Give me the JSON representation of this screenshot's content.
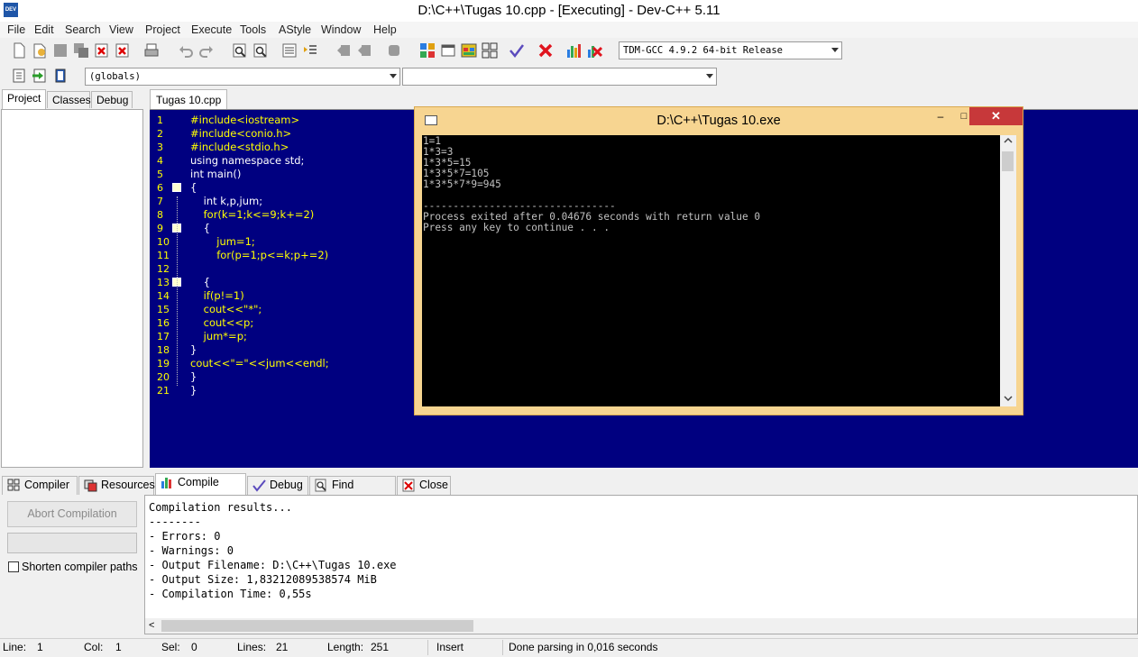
{
  "window": {
    "title": "D:\\C++\\Tugas 10.cpp - [Executing] - Dev-C++ 5.11",
    "app_icon_text": "DEV"
  },
  "menu": [
    "File",
    "Edit",
    "Search",
    "View",
    "Project",
    "Execute",
    "Tools",
    "AStyle",
    "Window",
    "Help"
  ],
  "toolbar": {
    "compiler": "TDM-GCC 4.9.2 64-bit Release",
    "scope": "(globals)",
    "members": ""
  },
  "left_panel": {
    "tabs": [
      "Project",
      "Classes",
      "Debug"
    ],
    "active_tab": "Project"
  },
  "editor": {
    "tab_label": "Tugas 10.cpp",
    "lines": [
      {
        "n": "1",
        "text": "#include<iostream>"
      },
      {
        "n": "2",
        "text": "#include<conio.h>"
      },
      {
        "n": "3",
        "text": "#include<stdio.h>"
      },
      {
        "n": "4",
        "text": "using namespace std;"
      },
      {
        "n": "5",
        "text": "int main()"
      },
      {
        "n": "6",
        "text": "{"
      },
      {
        "n": "7",
        "text": "    int k,p,jum;"
      },
      {
        "n": "8",
        "text": "    for(k=1;k<=9;k+=2)"
      },
      {
        "n": "9",
        "text": "    {"
      },
      {
        "n": "10",
        "text": "        jum=1;"
      },
      {
        "n": "11",
        "text": "        for(p=1;p<=k;p+=2)"
      },
      {
        "n": "12",
        "text": ""
      },
      {
        "n": "13",
        "text": "    {"
      },
      {
        "n": "14",
        "text": "    if(p!=1)"
      },
      {
        "n": "15",
        "text": "    cout<<\"*\";"
      },
      {
        "n": "16",
        "text": "    cout<<p;"
      },
      {
        "n": "17",
        "text": "    jum*=p;"
      },
      {
        "n": "18",
        "text": "}"
      },
      {
        "n": "19",
        "text": "cout<<\"=\"<<jum<<endl;"
      },
      {
        "n": "20",
        "text": "}"
      },
      {
        "n": "21",
        "text": "}"
      }
    ]
  },
  "console": {
    "title": "D:\\C++\\Tugas 10.exe",
    "min": "–",
    "max": "□",
    "close": "✕",
    "output": [
      "1=1",
      "1*3=3",
      "1*3*5=15",
      "1*3*5*7=105",
      "1*3*5*7*9=945",
      "",
      "--------------------------------",
      "Process exited after 0.04676 seconds with return value 0",
      "Press any key to continue . . ."
    ]
  },
  "bottom_panel": {
    "tabs": [
      {
        "label": "Compiler",
        "icon": "grid-icon"
      },
      {
        "label": "Resources",
        "icon": "resources-icon"
      },
      {
        "label": "Compile Log",
        "icon": "chart-icon"
      },
      {
        "label": "Debug",
        "icon": "check-icon"
      },
      {
        "label": "Find Results",
        "icon": "search-icon"
      },
      {
        "label": "Close",
        "icon": "close-icon"
      }
    ],
    "active_tab": "Compile Log",
    "abort_button": "Abort Compilation",
    "shorten_paths_label": "Shorten compiler paths",
    "log": [
      "Compilation results...",
      "--------",
      "- Errors: 0",
      "- Warnings: 0",
      "- Output Filename: D:\\C++\\Tugas 10.exe",
      "- Output Size: 1,83212089538574 MiB",
      "- Compilation Time: 0,55s"
    ],
    "scroll_left": "<"
  },
  "status": {
    "line_label": "Line:",
    "line_value": "1",
    "col_label": "Col:",
    "col_value": "1",
    "sel_label": "Sel:",
    "sel_value": "0",
    "lines_label": "Lines:",
    "lines_value": "21",
    "length_label": "Length:",
    "length_value": "251",
    "mode": "Insert",
    "message": "Done parsing in 0,016 seconds"
  }
}
